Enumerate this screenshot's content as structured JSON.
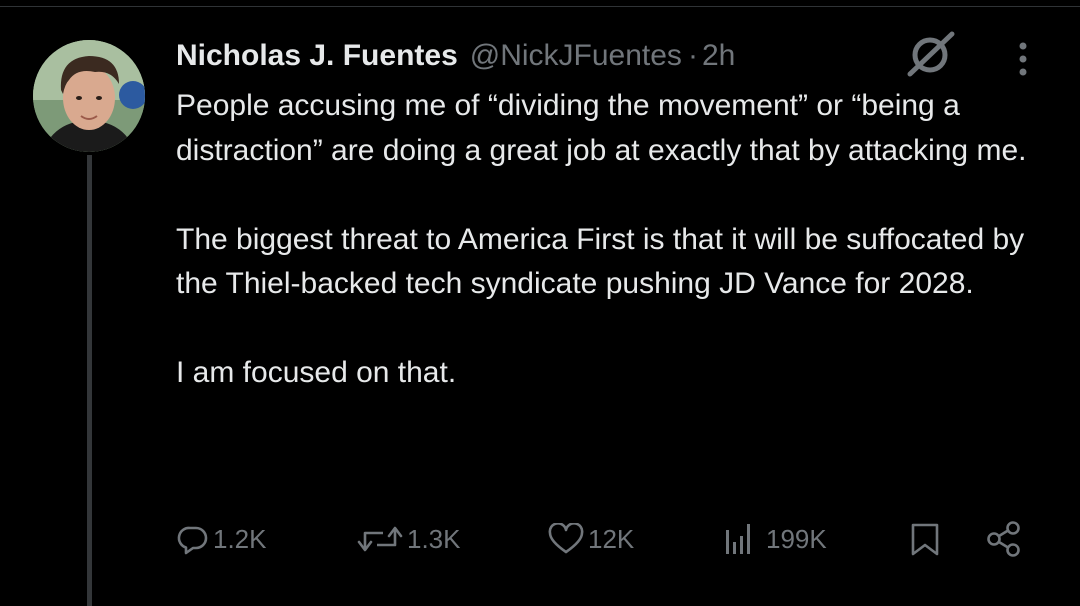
{
  "post": {
    "author": {
      "display_name": "Nicholas J. Fuentes",
      "handle": "@NickJFuentes",
      "avatar_icon": "profile-photo"
    },
    "separator": "·",
    "time": "2h",
    "paragraphs": [
      "People accusing me of “dividing the movement” or “being a distraction” are doing a great job at exactly that by attacking me.",
      "The biggest threat to America First is that it will be suffocated by the Thiel-backed tech syndicate pushing JD Vance for 2028.",
      "I am focused on that."
    ],
    "actions": {
      "replies": "1.2K",
      "reposts": "1.3K",
      "likes": "12K",
      "views": "199K"
    },
    "icons": {
      "grok": "grok-icon",
      "more": "more-vertical-icon",
      "reply": "reply-icon",
      "repost": "repost-icon",
      "like": "heart-icon",
      "views": "views-bar-chart-icon",
      "bookmark": "bookmark-icon",
      "share": "share-icon"
    }
  },
  "colors": {
    "background": "#000000",
    "text_primary": "#e7e9ea",
    "text_secondary": "#71767b",
    "thread_line": "#333639"
  }
}
